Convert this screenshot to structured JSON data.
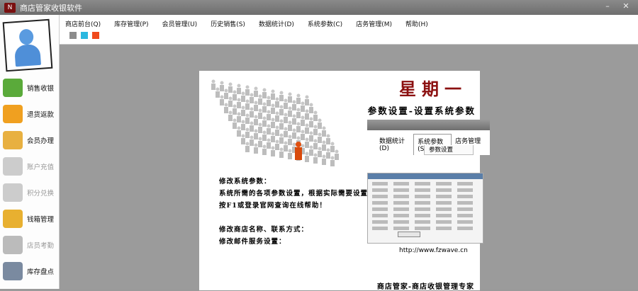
{
  "window": {
    "title": "商店管家收银软件",
    "minimize": "–",
    "close": "✕"
  },
  "menu": [
    "商店前台(Q)",
    "库存管理(P)",
    "会员管理(U)",
    "历史销售(S)",
    "数据统计(D)",
    "系统参数(C)",
    "店务管理(M)",
    "帮助(H)"
  ],
  "swatches": [
    "#8c8c8c",
    "#2bb8e0",
    "#f04a1c"
  ],
  "sidebar": [
    {
      "label": "销售收银",
      "enabled": true,
      "color": "#5aaa3a"
    },
    {
      "label": "退货返款",
      "enabled": true,
      "color": "#f0a020"
    },
    {
      "label": "会员办理",
      "enabled": true,
      "color": "#e8b040"
    },
    {
      "label": "账户充值",
      "enabled": false,
      "color": "#cccccc"
    },
    {
      "label": "积分兑换",
      "enabled": false,
      "color": "#cccccc"
    },
    {
      "label": "钱箱管理",
      "enabled": true,
      "color": "#e8b030"
    },
    {
      "label": "店员考勤",
      "enabled": false,
      "color": "#bbbbbb"
    },
    {
      "label": "库存盘点",
      "enabled": true,
      "color": "#7a8aa0"
    }
  ],
  "poster": {
    "day": "星期一",
    "subtitle": "参数设置-设置系统参数",
    "shot_tabs": [
      "数据统计(D)",
      "系统参数(S)",
      "店务管理(M)"
    ],
    "shot_dropdown": "参数设置",
    "lines": [
      "修改系统参数：",
      "系统所需的各项参数设置，根据实际需要设置",
      "按F1或登录官网查询在线帮助！",
      "",
      "修改商店名称、联系方式：",
      "修改邮件服务设置："
    ],
    "url": "http://www.fzwave.cn",
    "footer": "商店管家-商店收银管理专家"
  }
}
